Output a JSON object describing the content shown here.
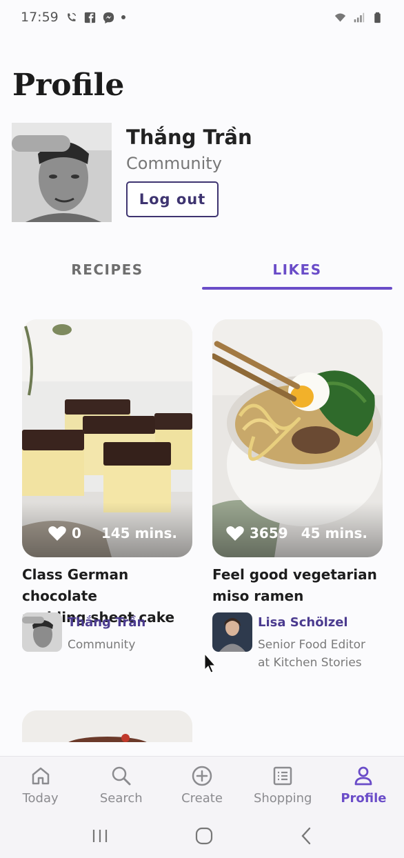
{
  "status_bar": {
    "time": "17:59"
  },
  "page": {
    "title": "Profile"
  },
  "profile": {
    "name": "Thắng Trần",
    "role": "Community",
    "logout_label": "Log out"
  },
  "tabs": [
    {
      "label": "RECIPES",
      "selected": false
    },
    {
      "label": "LIKES",
      "selected": true
    }
  ],
  "cards": [
    {
      "likes": "0",
      "mins": "145 mins.",
      "title_line1": "Class German chocolate",
      "title_line2": "pudding sheet cake",
      "author_name": "Thắng Trần",
      "author_role_line1": "Community",
      "author_role_line2": ""
    },
    {
      "likes": "3659",
      "mins": "45 mins.",
      "title_line1": "Feel good vegetarian",
      "title_line2": "miso ramen",
      "author_name": "Lisa Schölzel",
      "author_role_line1": "Senior Food Editor",
      "author_role_line2": "at Kitchen Stories"
    }
  ],
  "bottom_nav": [
    {
      "label": "Today",
      "icon": "home-icon",
      "active": false
    },
    {
      "label": "Search",
      "icon": "search-icon",
      "active": false
    },
    {
      "label": "Create",
      "icon": "plus-circle-icon",
      "active": false
    },
    {
      "label": "Shopping",
      "icon": "list-icon",
      "active": false
    },
    {
      "label": "Profile",
      "icon": "person-icon",
      "active": true
    }
  ],
  "colors": {
    "accent": "#6a4cc8",
    "button_border": "#3e3470",
    "author_link": "#4b3b8f"
  }
}
